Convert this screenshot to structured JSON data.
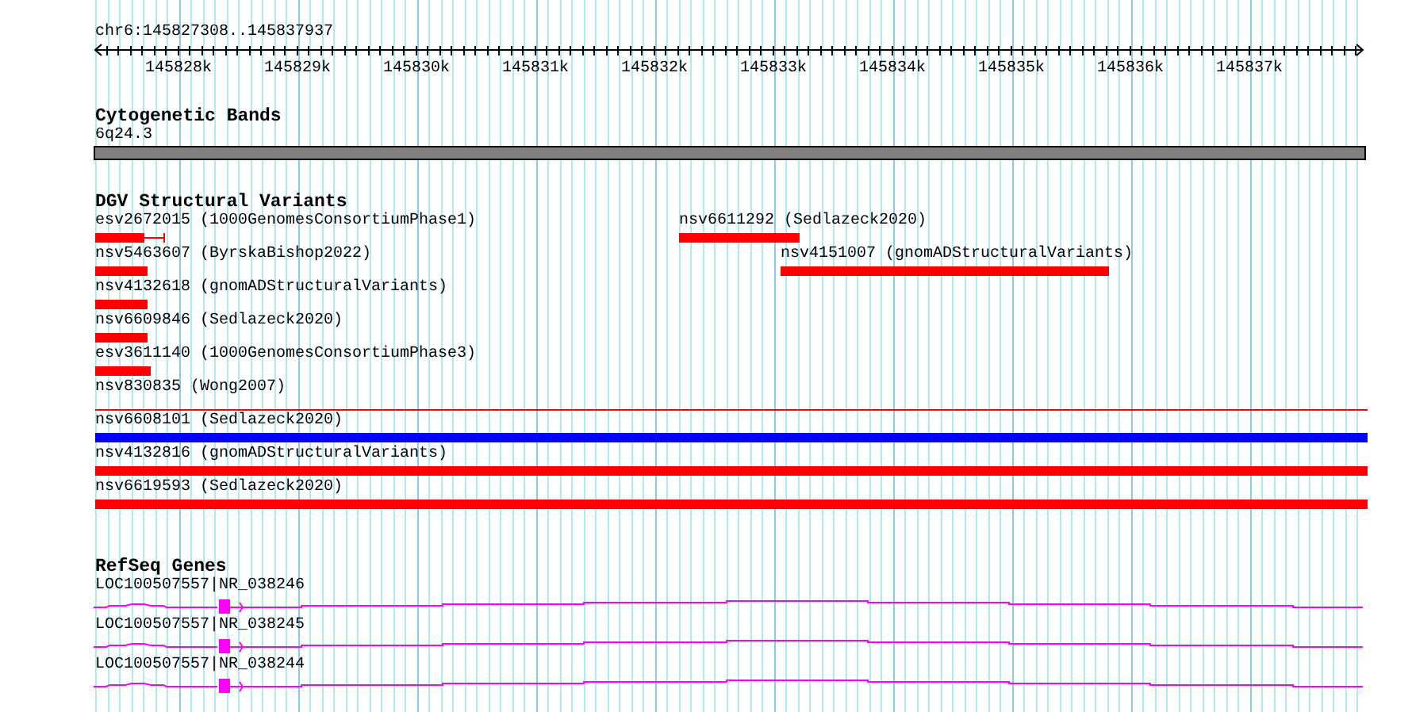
{
  "ruler": {
    "location": "chr6:145827308..145837937",
    "ticks": [
      "145828k",
      "145829k",
      "145830k",
      "145831k",
      "145832k",
      "145833k",
      "145834k",
      "145835k",
      "145836k",
      "145837k"
    ]
  },
  "tracks": [
    {
      "kind": "bands",
      "title": "Cytogenetic Bands",
      "features": [
        {
          "label": "6q24.3"
        }
      ]
    },
    {
      "kind": "variants",
      "title": "DGV Structural Variants",
      "rows": [
        [
          {
            "label": "esv2672015 (1000GenomesConsortiumPhase1)",
            "color": "#ff0000",
            "kind": "capped"
          },
          {
            "label": "nsv6611292 (Sedlazeck2020)",
            "color": "#ff0000",
            "kind": "bar"
          }
        ],
        [
          {
            "label": "nsv5463607 (ByrskaBishop2022)",
            "color": "#ff0000",
            "kind": "bar"
          },
          {
            "label": "nsv4151007 (gnomADStructuralVariants)",
            "color": "#ff0000",
            "kind": "bar"
          }
        ],
        [
          {
            "label": "nsv4132618 (gnomADStructuralVariants)",
            "color": "#ff0000",
            "kind": "bar"
          }
        ],
        [
          {
            "label": "nsv6609846 (Sedlazeck2020)",
            "color": "#ff0000",
            "kind": "bar"
          }
        ],
        [
          {
            "label": "esv3611140 (1000GenomesConsortiumPhase3)",
            "color": "#ff0000",
            "kind": "bar"
          }
        ],
        [
          {
            "label": "nsv830835 (Wong2007)",
            "color": "#ff0000",
            "kind": "line"
          }
        ],
        [
          {
            "label": "nsv6608101 (Sedlazeck2020)",
            "color": "#0000ff",
            "kind": "bar"
          }
        ],
        [
          {
            "label": "nsv4132816 (gnomADStructuralVariants)",
            "color": "#ff0000",
            "kind": "bar"
          }
        ],
        [
          {
            "label": "nsv6619593 (Sedlazeck2020)",
            "color": "#ff0000",
            "kind": "bar"
          }
        ]
      ]
    },
    {
      "kind": "genes",
      "title": "RefSeq Genes",
      "features": [
        {
          "label": "LOC100507557|NR_038246"
        },
        {
          "label": "LOC100507557|NR_038245"
        },
        {
          "label": "LOC100507557|NR_038244"
        }
      ]
    }
  ]
}
